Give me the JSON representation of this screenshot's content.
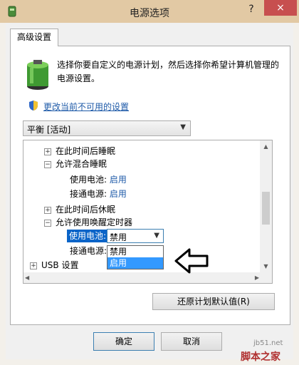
{
  "window": {
    "title": "电源选项",
    "help": "?",
    "close": "×"
  },
  "tab": {
    "label": "高级设置"
  },
  "description": "选择你要自定义的电源计划，然后选择你希望计算机管理的电源设置。",
  "link": "更改当前不可用的设置",
  "plan_select": {
    "value": "平衡 [活动]"
  },
  "tree": {
    "sleep_after": "在此时间后睡眠",
    "hybrid_sleep": "允许混合睡眠",
    "hybrid_battery": {
      "label": "使用电池:",
      "value": "启用"
    },
    "hybrid_ac": {
      "label": "接通电源:",
      "value": "启用"
    },
    "hibernate_after": "在此时间后休眠",
    "wake_timers": "允许使用唤醒定时器",
    "wake_battery": {
      "label": "使用电池:",
      "value": "禁用"
    },
    "wake_ac": {
      "label": "接通电源:"
    },
    "usb": "USB 设置"
  },
  "dropdown_options": [
    "禁用",
    "启用"
  ],
  "buttons": {
    "restore": "还原计划默认值(R)",
    "ok": "确定",
    "cancel": "取消"
  },
  "watermark": {
    "line1": "jb51.net",
    "line2": "脚本之家"
  },
  "colors": {
    "titlebar": "#e2c9a4",
    "close": "#c74f4f",
    "link": "#1e5aa8",
    "selection": "#3399ff"
  }
}
